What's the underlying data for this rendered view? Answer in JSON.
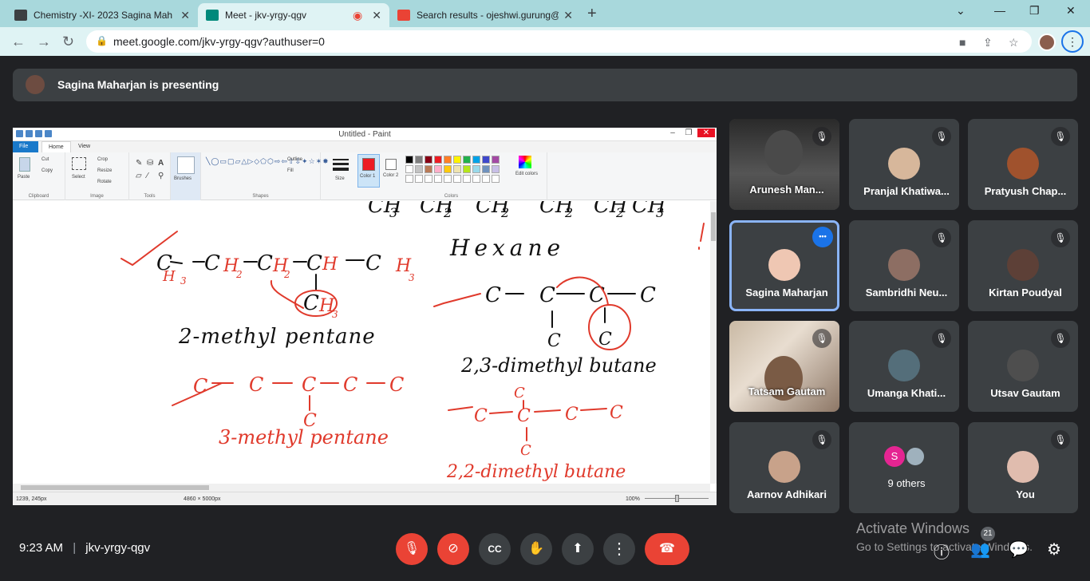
{
  "browser": {
    "tabs": [
      {
        "title": "Chemistry -XI- 2023 Sagina Mah",
        "active": false
      },
      {
        "title": "Meet - jkv-yrgy-qgv",
        "active": true
      },
      {
        "title": "Search results - ojeshwi.gurung@",
        "active": false
      }
    ],
    "url": "meet.google.com/jkv-yrgy-qgv?authuser=0"
  },
  "presenting": {
    "text": "Sagina Maharjan is presenting"
  },
  "paint": {
    "title": "Untitled - Paint",
    "tabs": [
      "File",
      "Home",
      "View"
    ],
    "ribbon": {
      "paste": "Paste",
      "cut": "Cut",
      "copy": "Copy",
      "select": "Select",
      "crop": "Crop",
      "resize": "Resize",
      "rotate": "Rotate",
      "brushes": "Brushes",
      "outline": "Outline",
      "fill": "Fill",
      "size": "Size",
      "color1": "Color 1",
      "color2": "Color 2",
      "edit_colors": "Edit colors",
      "groups": [
        "Clipboard",
        "Image",
        "Tools",
        "Shapes",
        "Colors"
      ]
    },
    "colors": {
      "row1": [
        "#000000",
        "#7f7f7f",
        "#880015",
        "#ed1c24",
        "#ff7f27",
        "#fff200",
        "#22b14c",
        "#00a2e8",
        "#3f48cc",
        "#a349a4"
      ],
      "row2": [
        "#ffffff",
        "#c3c3c3",
        "#b97a57",
        "#ffaec9",
        "#ffc90e",
        "#efe4b0",
        "#b5e61d",
        "#99d9ea",
        "#7092be",
        "#c8bfe7"
      ],
      "color1": "#ed1c24",
      "color2": "#ffffff"
    },
    "handwriting": {
      "ch3_top": "CH",
      "three": "3",
      "ch2_a": "CH",
      "two_a": "2",
      "ch2_b": "CH",
      "two_b": "2",
      "ch2_c": "CH",
      "two_c": "2",
      "ch2_d": "CH",
      "two_d": "2",
      "ch3_end": "CH",
      "three_end": "3",
      "hexane": "Hexane",
      "chain_c1": "C",
      "chain_h3": "H",
      "sub3": "3",
      "chain_c2": "C",
      "chain_h2a": "H",
      "sub2a": "2",
      "chain_c3": "C",
      "chain_h2b": "H",
      "sub2b": "2",
      "chain_c4": "C",
      "chain_h": "H",
      "chain_c5": "C",
      "chain_h3b": "H",
      "sub3b": "3",
      "branch_c": "C",
      "branch_h3": "H",
      "branch_sub": "3",
      "name1": "2-methyl pentane",
      "c3p": [
        "C",
        "C",
        "C",
        "C",
        "C"
      ],
      "c3p_branch": "C",
      "name2": "3-methyl pentane",
      "c23": [
        "C",
        "C",
        "C",
        "C"
      ],
      "c23_b1": "C",
      "c23_b2": "C",
      "name3": "2,3-dimethyl butane",
      "c22": [
        "C",
        "C",
        "C",
        "C"
      ],
      "c22_top": "C",
      "c22_bot": "C",
      "name4": "2,2-dimethyl butane"
    },
    "status": {
      "cursor": "1239, 245px",
      "size": "4860 × 5000px",
      "zoom": "100%"
    }
  },
  "participants": [
    {
      "name": "Arunesh Man...",
      "muted": true,
      "video": true,
      "speaking": false
    },
    {
      "name": "Pranjal Khatiwa...",
      "muted": true,
      "video": false,
      "speaking": false
    },
    {
      "name": "Pratyush Chap...",
      "muted": true,
      "video": false,
      "speaking": false
    },
    {
      "name": "Sagina Maharjan",
      "muted": false,
      "video": false,
      "speaking": true
    },
    {
      "name": "Sambridhi Neu...",
      "muted": true,
      "video": false,
      "speaking": false
    },
    {
      "name": "Kirtan Poudyal",
      "muted": true,
      "video": false,
      "speaking": false
    },
    {
      "name": "Tatsam Gautam",
      "muted": true,
      "video": true,
      "speaking": false
    },
    {
      "name": "Umanga Khati...",
      "muted": true,
      "video": false,
      "speaking": false
    },
    {
      "name": "Utsav Gautam",
      "muted": true,
      "video": false,
      "speaking": false
    },
    {
      "name": "Aarnov Adhikari",
      "muted": true,
      "video": false,
      "speaking": false
    },
    {
      "name": "9 others",
      "muted": false,
      "video": false,
      "speaking": false
    },
    {
      "name": "You",
      "muted": true,
      "video": false,
      "speaking": false
    }
  ],
  "others_avatar_letter": "S",
  "bottom": {
    "time": "9:23 AM",
    "meeting_code": "jkv-yrgy-qgv",
    "participant_count": "21"
  },
  "watermark": {
    "line1": "Activate Windows",
    "line2": "Go to Settings to activate Windows."
  },
  "colors": {
    "accent": "#8ab4f8",
    "danger": "#ea4335",
    "tile": "#3c4043",
    "background": "#202124",
    "ink": "#e03a2c"
  }
}
